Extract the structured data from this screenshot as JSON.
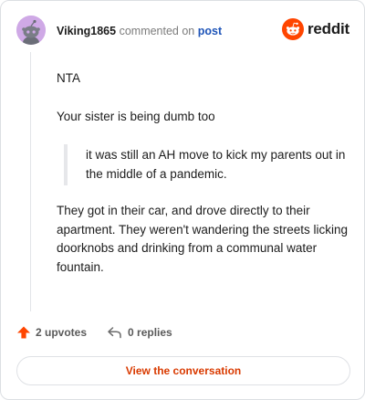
{
  "header": {
    "username": "Viking1865",
    "commented_text": "commented on",
    "post_link": "post"
  },
  "logo": {
    "word": "reddit",
    "icon": "reddit-alien-icon",
    "color": "#ff4500"
  },
  "comment": {
    "paragraph_1": "NTA",
    "paragraph_2": "Your sister is being dumb too",
    "quote": "it was still an AH move to kick my parents out in the middle of a pandemic.",
    "paragraph_3": "They got in their car, and drove directly to their apartment. They weren't wandering the streets licking doorknobs and drinking from a communal water fountain."
  },
  "footer": {
    "upvotes": "2 upvotes",
    "upvote_icon": "upvote-arrow-icon",
    "replies": "0 replies",
    "reply_icon": "reply-arrow-icon"
  },
  "cta": {
    "label": "View the conversation",
    "color": "#d93a00"
  }
}
